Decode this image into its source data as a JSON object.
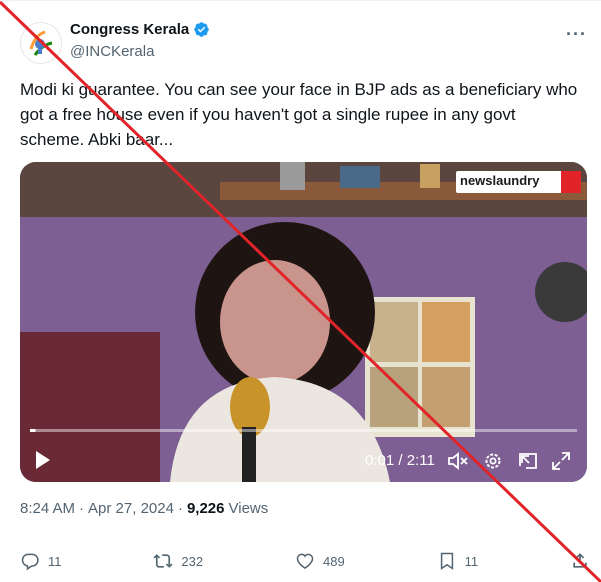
{
  "tweet": {
    "author_name": "Congress Kerala",
    "author_handle": "@INCKerala",
    "text": "Modi ki guarantee. You can see your face in BJP ads as a beneficiary who\ngot a free house even if you haven't got a single rupee in any govt\nscheme. Abki baar...",
    "verified_color": "#1d9bf0",
    "more_label": "···"
  },
  "video": {
    "watermark": "newslaundry",
    "time_current": "0:01",
    "time_sep": " / ",
    "time_total": "2:11",
    "progress_fraction": 0.01,
    "icons": [
      "play-icon",
      "mute-icon",
      "settings-icon",
      "pip-icon",
      "fullscreen-icon"
    ]
  },
  "meta": {
    "time": "8:24 AM",
    "sep1": "·",
    "date": "Apr 27, 2024",
    "sep2": "·",
    "views_count": "9,226",
    "views_label": "Views"
  },
  "actions": {
    "replies": "11",
    "reposts": "232",
    "likes": "489",
    "bookmarks": "11"
  },
  "overlay": {
    "cross_color": "#e0242a"
  }
}
